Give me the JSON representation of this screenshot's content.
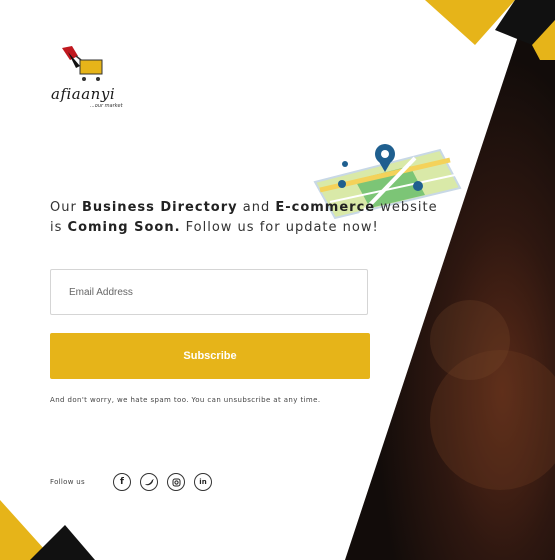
{
  "brand": {
    "name": "afiaanyi",
    "tagline": "...our market"
  },
  "headline": {
    "part1": "Our ",
    "bold1": "Business Directory",
    "part2": " and  ",
    "bold2": "E-commerce",
    "part3": " website is ",
    "bold3": "Coming Soon.",
    "part4": " Follow us for update now!"
  },
  "form": {
    "email_placeholder": "Email Address",
    "subscribe_label": "Subscribe"
  },
  "spam_note": "And don't worry, we hate spam too. You can unsubscribe at any time.",
  "follow": {
    "label": "Follow us",
    "icons": [
      "facebook-icon",
      "twitter-icon",
      "instagram-icon",
      "linkedin-icon"
    ]
  },
  "colors": {
    "accent": "#e6b419",
    "dark": "#1a1210",
    "map_green": "#7cc576",
    "pin_blue": "#1f5f8f"
  }
}
